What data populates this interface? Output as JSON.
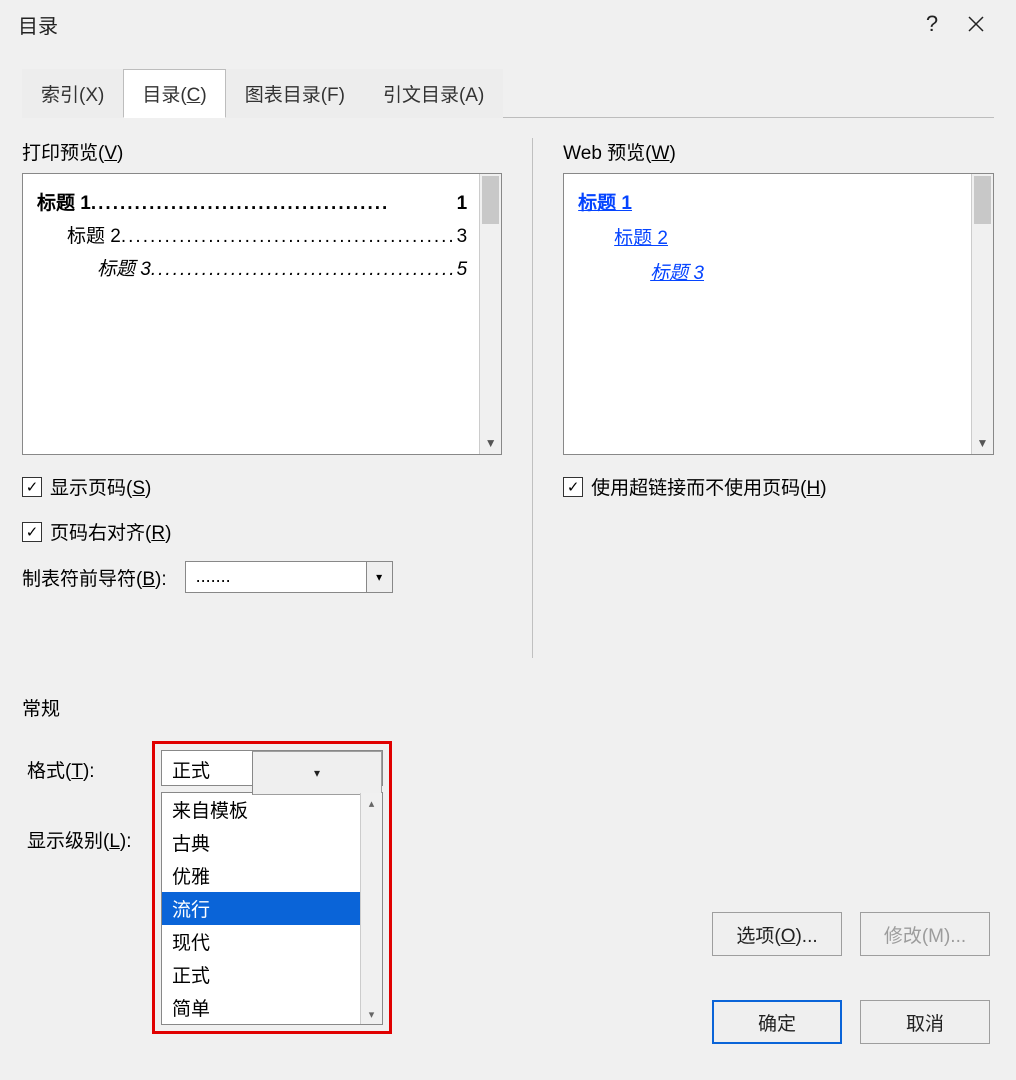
{
  "title": "目录",
  "tabs": {
    "index": "索引(X)",
    "toc_pre": "目录(",
    "toc_key": "C",
    "toc_post": ")",
    "figures": "图表目录(F)",
    "citations": "引文目录(A)"
  },
  "print_preview": {
    "label_pre": "打印预览(",
    "label_key": "V",
    "label_post": ")",
    "entries": [
      {
        "title": "标题 1",
        "leader": ".........................................",
        "page": "1"
      },
      {
        "title": "标题 2",
        "leader": "..............................................",
        "page": "3"
      },
      {
        "title": "标题 3",
        "leader": "..........................................",
        "page": "5"
      }
    ]
  },
  "web_preview": {
    "label_pre": "Web 预览(",
    "label_key": "W",
    "label_post": ")",
    "entries": [
      "标题 1",
      "标题 2",
      "标题 3"
    ]
  },
  "checkboxes": {
    "show_page_pre": "显示页码(",
    "show_page_key": "S",
    "show_page_post": ")",
    "right_align_pre": "页码右对齐(",
    "right_align_key": "R",
    "right_align_post": ")",
    "hyperlink_pre": "使用超链接而不使用页码(",
    "hyperlink_key": "H",
    "hyperlink_post": ")"
  },
  "tab_leader": {
    "label_pre": "制表符前导符(",
    "label_key": "B",
    "label_post": "):",
    "value": "......."
  },
  "general": {
    "title": "常规",
    "format_label_pre": "格式(",
    "format_label_key": "T",
    "format_label_post": "):",
    "format_value": "正式",
    "format_options": [
      "来自模板",
      "古典",
      "优雅",
      "流行",
      "现代",
      "正式",
      "简单"
    ],
    "highlighted_option": "流行",
    "level_label_pre": "显示级别(",
    "level_label_key": "L",
    "level_label_post": "):"
  },
  "buttons": {
    "options_pre": "选项(",
    "options_key": "O",
    "options_post": ")...",
    "modify": "修改(M)...",
    "ok": "确定",
    "cancel": "取消"
  }
}
